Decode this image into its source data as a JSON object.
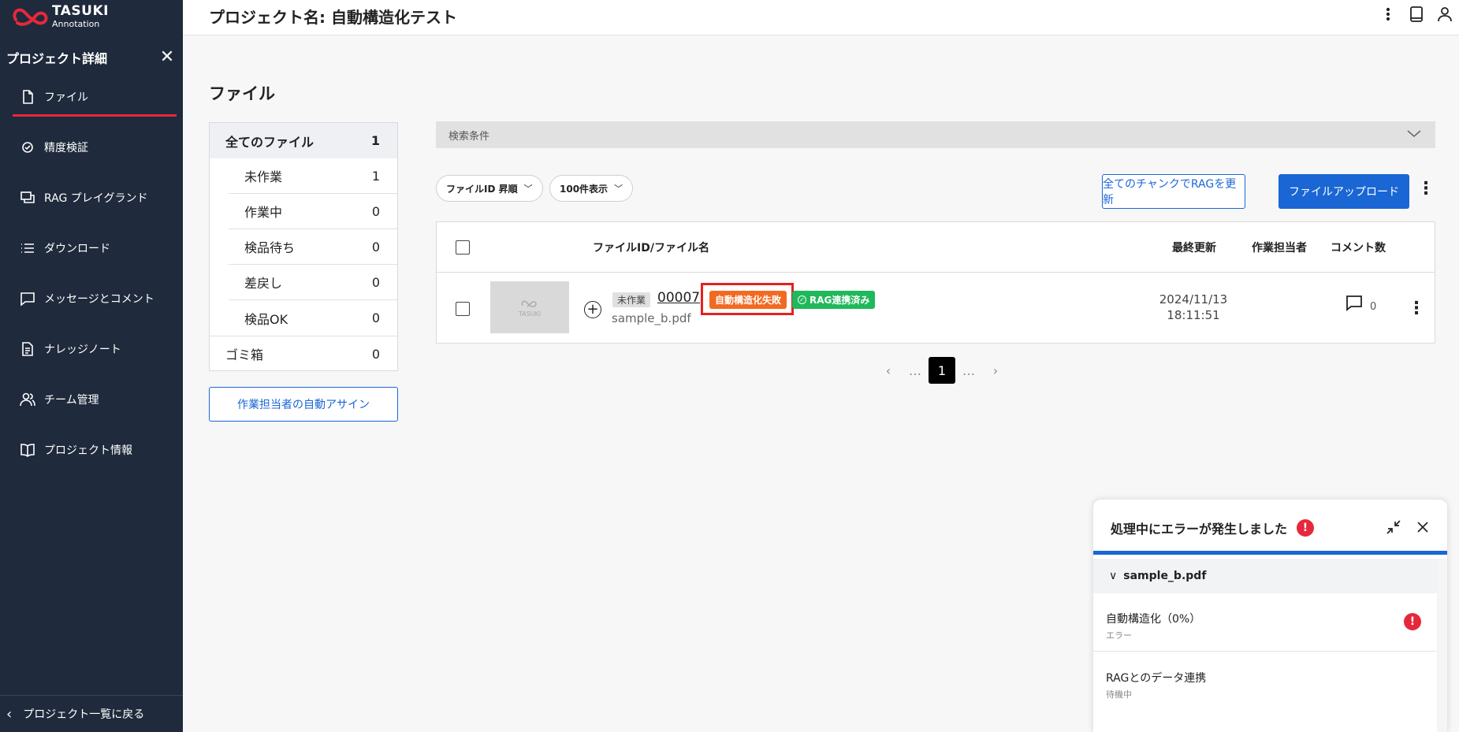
{
  "logo": {
    "line1": "TASUKI",
    "line2": "Annotation"
  },
  "sidebar": {
    "title": "プロジェクト詳細",
    "items": [
      {
        "label": "ファイル",
        "icon": "file-icon"
      },
      {
        "label": "精度検証",
        "icon": "accuracy-icon"
      },
      {
        "label": "RAG プレイグランド",
        "icon": "playground-icon"
      },
      {
        "label": "ダウンロード",
        "icon": "list-icon"
      },
      {
        "label": "メッセージとコメント",
        "icon": "message-icon"
      },
      {
        "label": "ナレッジノート",
        "icon": "document-icon"
      },
      {
        "label": "チーム管理",
        "icon": "team-icon"
      },
      {
        "label": "プロジェクト情報",
        "icon": "book-icon"
      }
    ],
    "back_label": "プロジェクト一覧に戻る"
  },
  "header": {
    "title": "プロジェクト名: 自動構造化テスト"
  },
  "page": {
    "heading": "ファイル"
  },
  "filters": {
    "all": {
      "label": "全てのファイル",
      "count": "1"
    },
    "statuses": [
      {
        "label": "未作業",
        "count": "1"
      },
      {
        "label": "作業中",
        "count": "0"
      },
      {
        "label": "検品待ち",
        "count": "0"
      },
      {
        "label": "差戻し",
        "count": "0"
      },
      {
        "label": "検品OK",
        "count": "0"
      }
    ],
    "trash": {
      "label": "ゴミ箱",
      "count": "0"
    },
    "auto_assign_label": "作業担当者の自動アサイン"
  },
  "search": {
    "label": "検索条件"
  },
  "controls": {
    "sort_label": "ファイルID 昇順",
    "per_page_label": "100件表示",
    "rag_update_label": "全てのチャンクでRAGを更新",
    "upload_label": "ファイルアップロード"
  },
  "table": {
    "headers": {
      "file": "ファイルID/ファイル名",
      "updated": "最終更新",
      "assignee": "作業担当者",
      "comments": "コメント数"
    },
    "rows": [
      {
        "status_tag": "未作業",
        "file_id": "00007",
        "badge_fail": "自動構造化失敗",
        "badge_rag": "RAG連携済み",
        "filename": "sample_b.pdf",
        "updated_date": "2024/11/13",
        "updated_time": "18:11:51",
        "assignee": "",
        "comment_count": "0",
        "thumb_text": "TASUKI"
      }
    ]
  },
  "pagination": {
    "prev": "‹",
    "ellipsis": "…",
    "current": "1",
    "next": "›"
  },
  "error_panel": {
    "title": "処理中にエラーが発生しました",
    "file": "sample_b.pdf",
    "steps": [
      {
        "title": "自動構造化（0%）",
        "status": "エラー"
      },
      {
        "title": "RAGとのデータ連携",
        "status": "待機中"
      }
    ]
  },
  "colors": {
    "sidebar_bg": "#1f2a3c",
    "accent_red": "#e6283c",
    "primary_blue": "#1a66d4",
    "fail_orange": "#f26a22",
    "rag_green": "#1fb85a"
  }
}
